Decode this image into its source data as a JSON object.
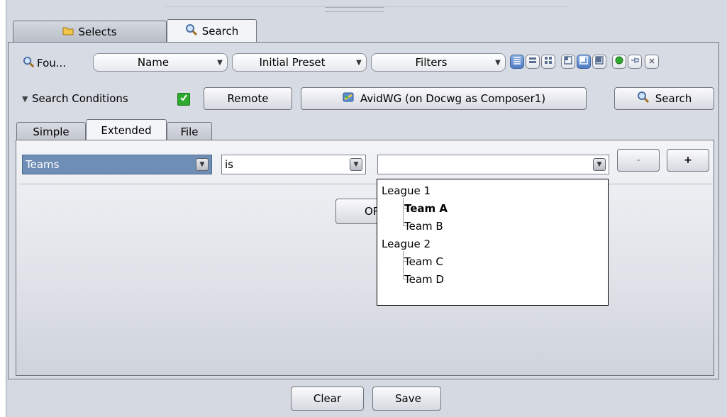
{
  "tabs": [
    {
      "label": "Selects",
      "icon": "folder-icon",
      "active": false
    },
    {
      "label": "Search",
      "icon": "magnifier-icon",
      "active": true
    }
  ],
  "toolbar": {
    "found_label": "Fou...",
    "name_select": "Name",
    "preset_select": "Initial Preset",
    "filters_select": "Filters"
  },
  "conditions": {
    "label": "Search Conditions",
    "checked": true,
    "remote_button": "Remote",
    "db_button": "AvidWG (on Docwg as Composer1)",
    "search_button": "Search"
  },
  "subtabs": [
    {
      "label": "Simple",
      "active": false
    },
    {
      "label": "Extended",
      "active": true
    },
    {
      "label": "File",
      "active": false
    }
  ],
  "criteria": {
    "field": "Teams",
    "operator": "is",
    "value": "",
    "minus_button": "-",
    "plus_button": "+",
    "or_button": "OR"
  },
  "dropdown": {
    "leagues": [
      {
        "label": "League 1",
        "teams": [
          {
            "label": "Team A",
            "highlighted": true
          },
          {
            "label": "Team B",
            "highlighted": false
          }
        ]
      },
      {
        "label": "League 2",
        "teams": [
          {
            "label": "Team C",
            "highlighted": false
          },
          {
            "label": "Team D",
            "highlighted": false
          }
        ]
      }
    ]
  },
  "footer": {
    "clear_button": "Clear",
    "save_button": "Save"
  },
  "colors": {
    "selection": "#6f8eb6",
    "accent_green": "#2eaa2e",
    "toggle_active": "#4f7cc4"
  }
}
